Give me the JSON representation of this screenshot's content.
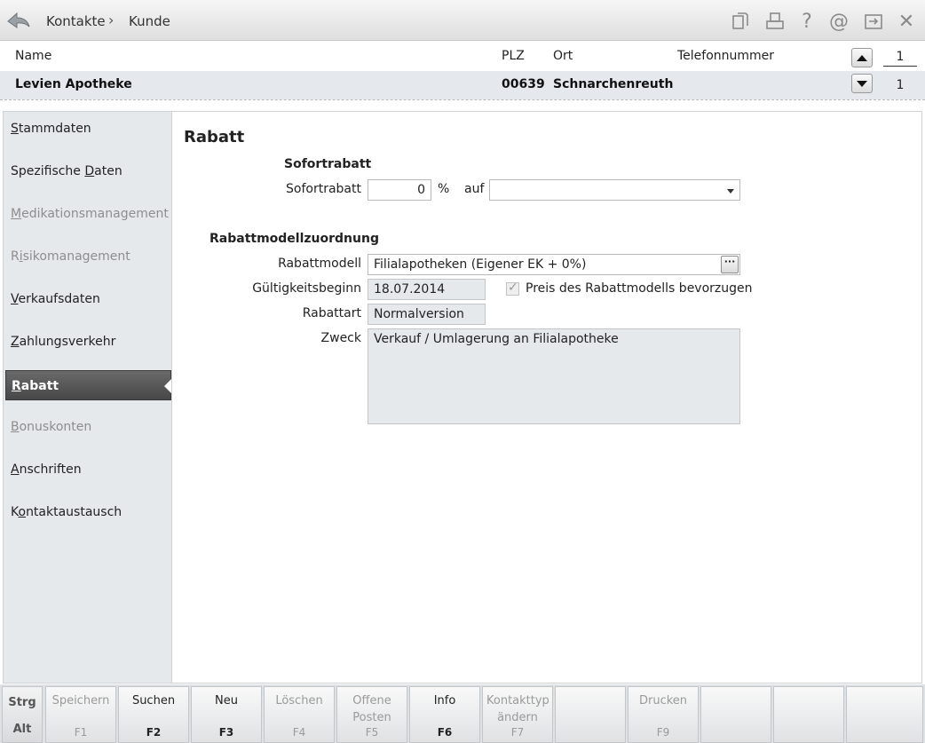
{
  "titlebar": {
    "breadcrumb": [
      "Kontakte",
      "Kunde"
    ],
    "icons": [
      "document-icon",
      "print-icon",
      "help-icon",
      "at-icon",
      "export-icon",
      "close-icon"
    ]
  },
  "list": {
    "headers": {
      "name": "Name",
      "plz": "PLZ",
      "ort": "Ort",
      "telefon": "Telefonnummer"
    },
    "row": {
      "name": "Levien Apotheke",
      "plz": "00639",
      "ort": "Schnarchenreuth",
      "telefon": ""
    },
    "count_top": "1",
    "count_bottom": "1"
  },
  "sidebar": {
    "items": [
      {
        "pre": "",
        "u": "S",
        "post": "tammdaten",
        "disabled": false
      },
      {
        "pre": "Spezifische ",
        "u": "D",
        "post": "aten",
        "disabled": false
      },
      {
        "pre": "",
        "u": "M",
        "post": "edikationsmanagement",
        "disabled": true
      },
      {
        "pre": "R",
        "u": "i",
        "post": "sikomanagement",
        "disabled": true
      },
      {
        "pre": "",
        "u": "V",
        "post": "erkaufsdaten",
        "disabled": false
      },
      {
        "pre": "",
        "u": "Z",
        "post": "ahlungsverkehr",
        "disabled": false
      },
      {
        "pre": "",
        "u": "R",
        "post": "abatt",
        "disabled": false,
        "active": true
      },
      {
        "pre": "",
        "u": "B",
        "post": "onuskonten",
        "disabled": true
      },
      {
        "pre": "",
        "u": "A",
        "post": "nschriften",
        "disabled": false
      },
      {
        "pre": "K",
        "u": "o",
        "post": "ntaktaustausch",
        "disabled": false
      }
    ]
  },
  "main": {
    "title": "Rabatt",
    "sofortrabatt": {
      "section": "Sofortrabatt",
      "label": "Sofortrabatt",
      "value": "0",
      "unit": "%",
      "auf_label": "auf",
      "auf_value": ""
    },
    "modell": {
      "section": "Rabattmodellzuordnung",
      "rabattmodell_label": "Rabattmodell",
      "rabattmodell_value": "Filialapotheken (Eigener EK + 0%)",
      "gueltig_label": "Gültigkeitsbeginn",
      "gueltig_value": "18.07.2014",
      "preis_label": "Preis des Rabattmodells bevorzugen",
      "rabattart_label": "Rabattart",
      "rabattart_value": "Normalversion",
      "zweck_label": "Zweck",
      "zweck_value": "Verkauf / Umlagerung an Filialapotheke"
    }
  },
  "fkeys": {
    "mod_top": "Strg",
    "mod_bottom": "Alt",
    "keys": [
      {
        "label": "Speichern",
        "key": "F1",
        "disabled": true
      },
      {
        "label": "Suchen",
        "key": "F2",
        "disabled": false
      },
      {
        "label": "Neu",
        "key": "F3",
        "disabled": false
      },
      {
        "label": "Löschen",
        "key": "F4",
        "disabled": true
      },
      {
        "label": "Offene Posten",
        "key": "F5",
        "disabled": true
      },
      {
        "label": "Info",
        "key": "F6",
        "disabled": false
      },
      {
        "label": "Kontakttyp ändern",
        "key": "F7",
        "disabled": true
      },
      {
        "label": "",
        "key": "",
        "disabled": true
      },
      {
        "label": "Drucken",
        "key": "F9",
        "disabled": true
      },
      {
        "label": "",
        "key": "",
        "disabled": true
      },
      {
        "label": "",
        "key": "",
        "disabled": true
      },
      {
        "label": "",
        "key": "",
        "disabled": true
      }
    ]
  }
}
